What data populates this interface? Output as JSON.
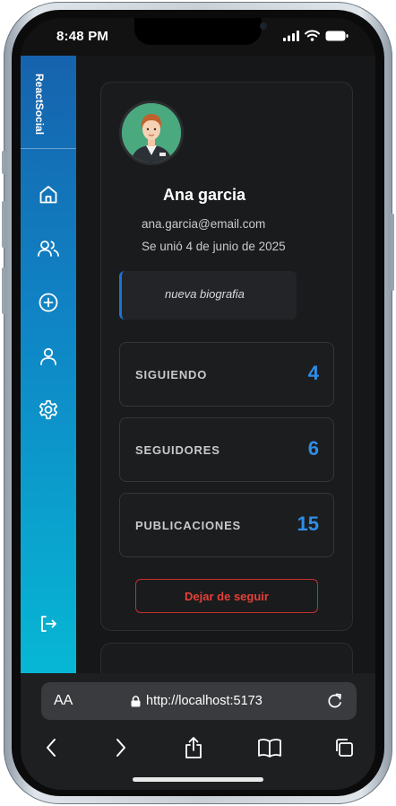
{
  "status_bar": {
    "time": "8:48 PM"
  },
  "sidebar": {
    "brand": "ReactSocial",
    "items": [
      {
        "icon": "home-icon"
      },
      {
        "icon": "users-icon"
      },
      {
        "icon": "plus-circle-icon"
      },
      {
        "icon": "user-icon"
      },
      {
        "icon": "gear-icon"
      }
    ],
    "logout_icon": "logout-icon"
  },
  "profile": {
    "name": "Ana garcia",
    "email": "ana.garcia@email.com",
    "joined": "Se unió 4 de junio de 2025",
    "bio": "nueva biografia",
    "stats": [
      {
        "label": "SIGUIENDO",
        "value": "4"
      },
      {
        "label": "SEGUIDORES",
        "value": "6"
      },
      {
        "label": "PUBLICACIONES",
        "value": "15"
      }
    ],
    "unfollow_label": "Dejar de seguir"
  },
  "browser": {
    "text_size_label": "AA",
    "url": "http://localhost:5173"
  },
  "colors": {
    "accent": "#2e8ee8",
    "danger": "#e5403a",
    "sidebar_top": "#1663ad",
    "sidebar_bottom": "#07b7d4"
  }
}
